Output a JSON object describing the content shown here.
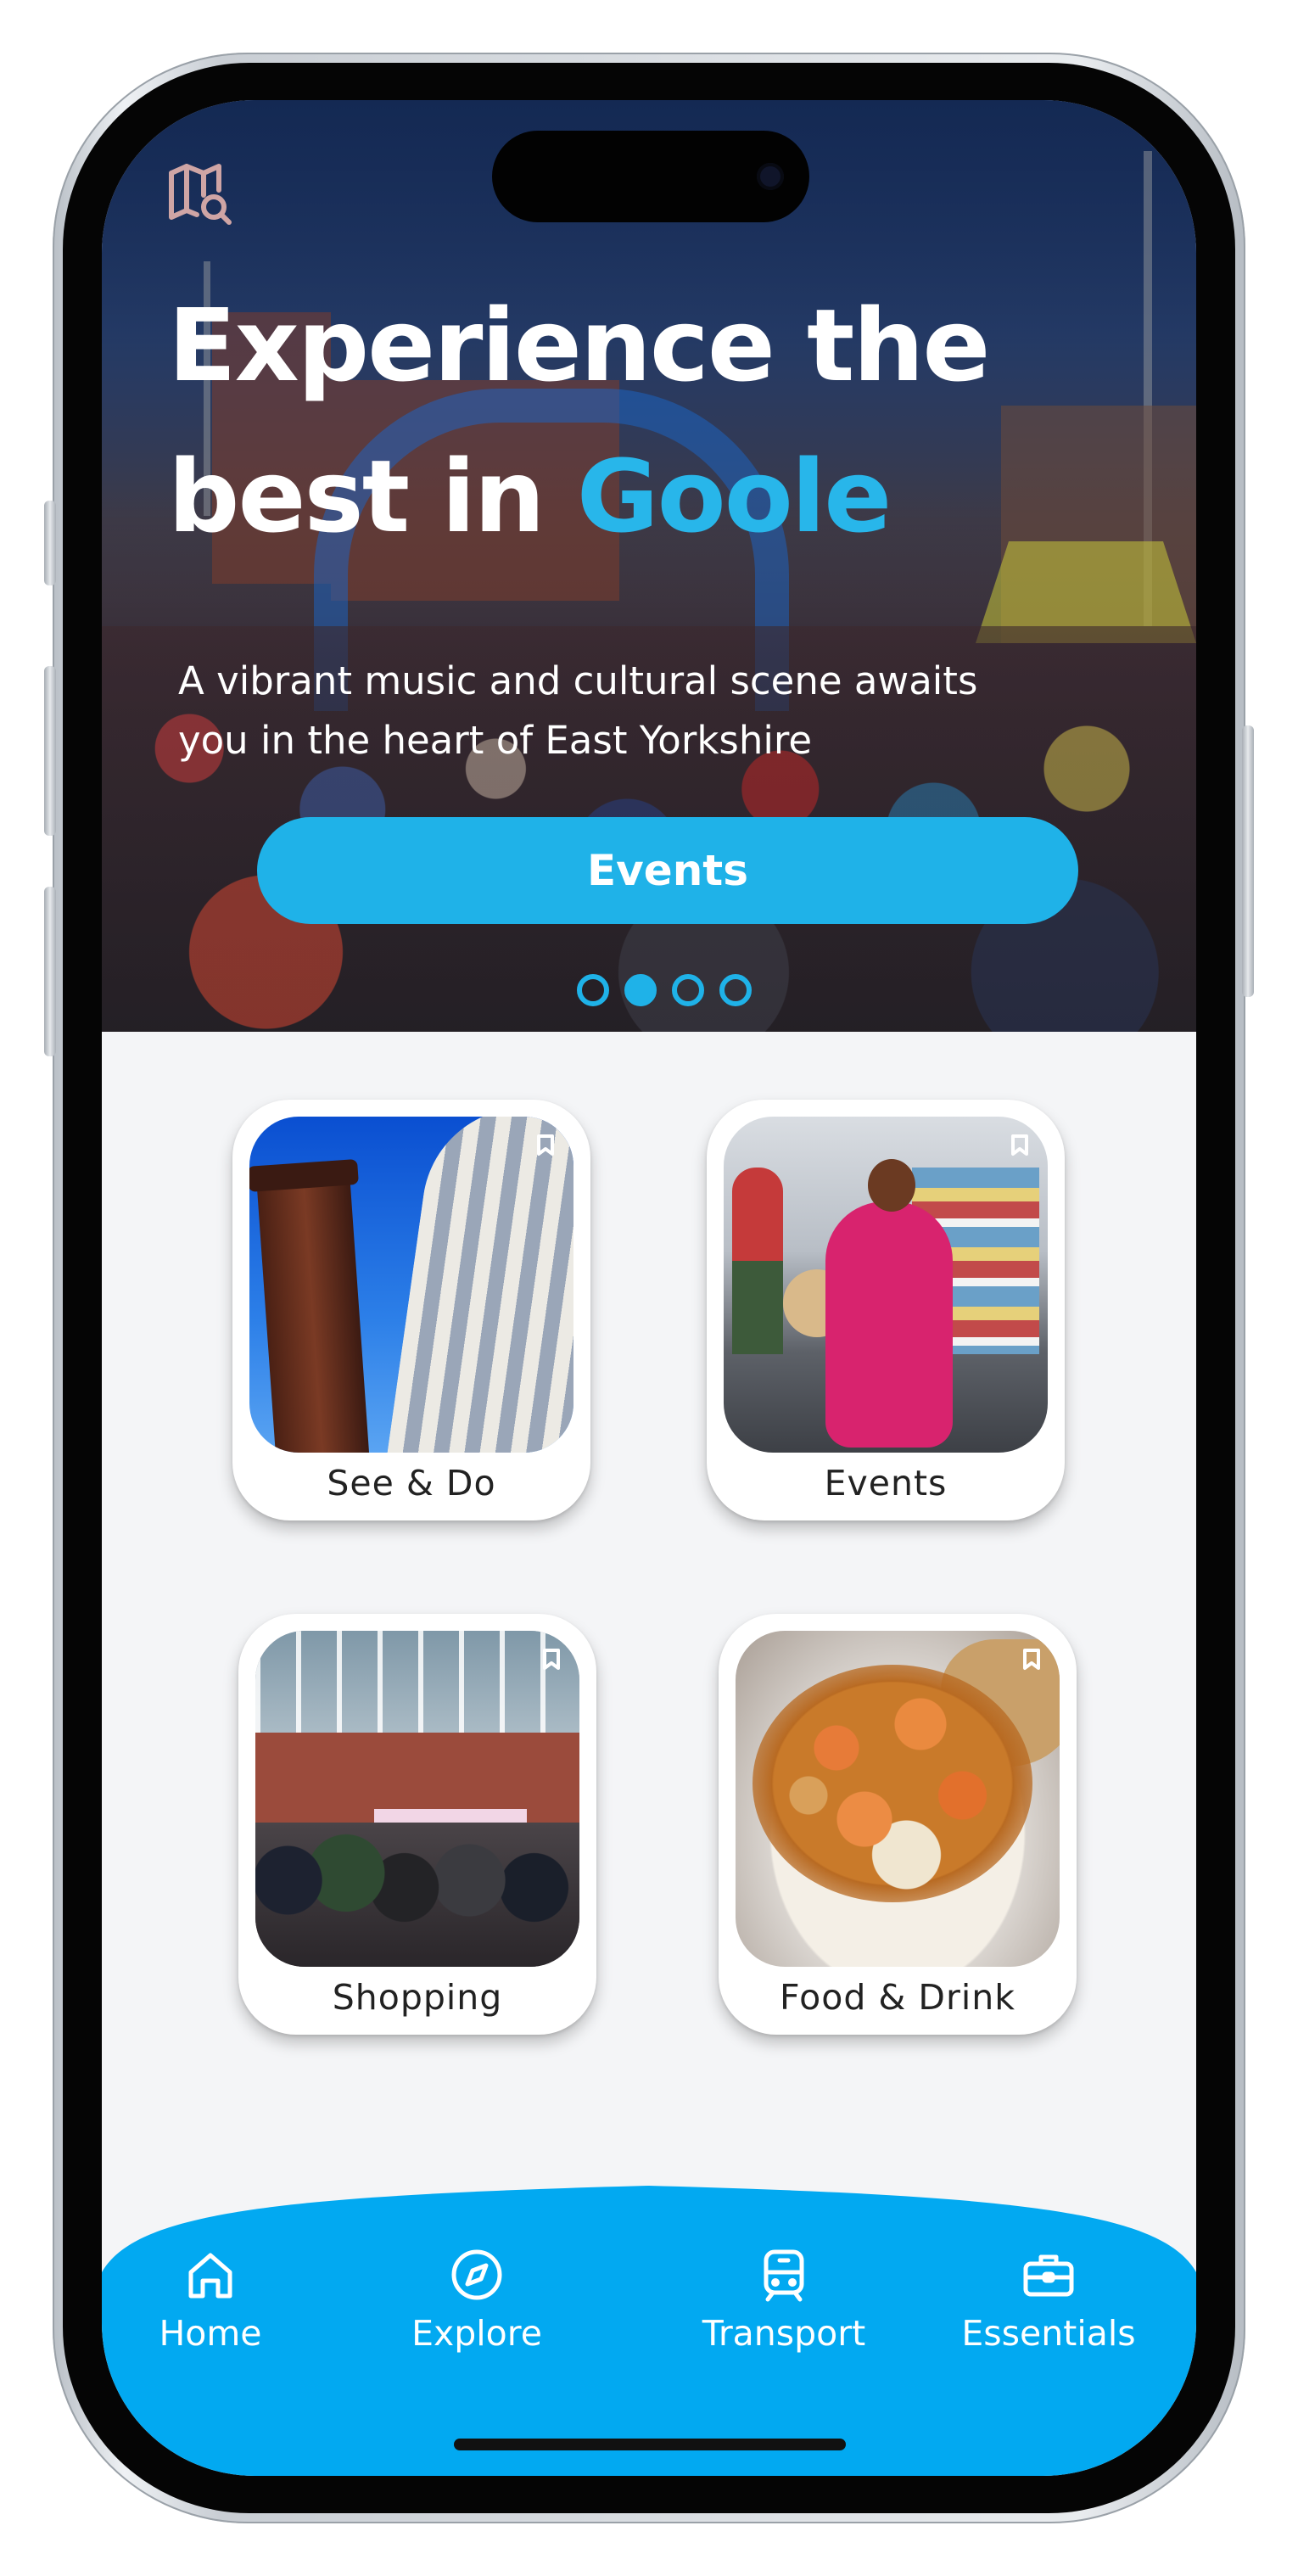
{
  "hero": {
    "headline_line1": "Experience the",
    "headline_line2_prefix": "best in",
    "headline_accent": "Goole",
    "subtitle_line1": "A vibrant music and cultural scene awaits",
    "subtitle_line2": "you in the heart of East Yorkshire",
    "cta_label": "Events",
    "carousel_total": 4,
    "carousel_active_index": 1,
    "map_icon": "map-search-icon"
  },
  "categories": [
    {
      "label": "See & Do",
      "icon": "bookmark-icon"
    },
    {
      "label": "Events",
      "icon": "bookmark-icon"
    },
    {
      "label": "Shopping",
      "icon": "bookmark-icon"
    },
    {
      "label": "Food & Drink",
      "icon": "bookmark-icon"
    }
  ],
  "nav": {
    "items": [
      {
        "label": "Home",
        "icon": "home-icon"
      },
      {
        "label": "Explore",
        "icon": "compass-icon"
      },
      {
        "label": "Transport",
        "icon": "train-icon"
      },
      {
        "label": "Essentials",
        "icon": "briefcase-icon"
      }
    ]
  },
  "colors": {
    "accent": "#1fb2e8",
    "nav_background": "#02a9f1",
    "screen_background": "#f4f5f7"
  }
}
